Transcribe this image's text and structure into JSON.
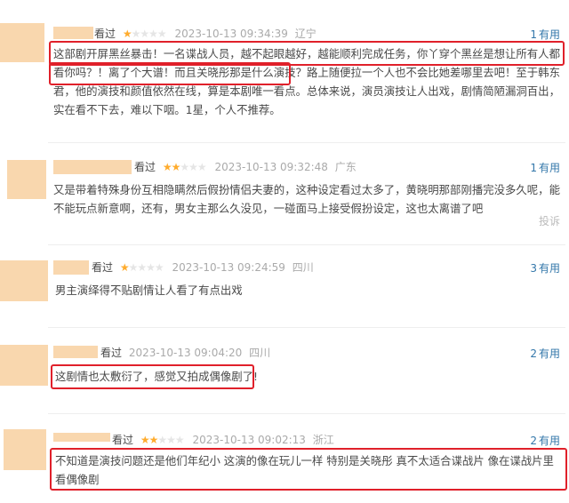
{
  "reviews": [
    {
      "watched": "看过",
      "stars": 1,
      "time": "2023-10-13 09:34:39",
      "location": "辽宁",
      "useful_count": "1",
      "useful_label": "有用",
      "content": "这部剧开屏黑丝暴击！一名谍战人员，越不起眼越好，越能顺利完成任务，你丫穿个黑丝是想让所有人都看你吗？！离了个大谱！而且关晓彤那是什么演技？路上随便拉一个人也不会比她差哪里去吧！至于韩东君，他的演技和颜值依然在线，算是本剧唯一看点。总体来说，演员演技让人出戏，剧情简陋漏洞百出，实在看不下去，难以下咽。1星，个人不推荐。"
    },
    {
      "watched": "看过",
      "stars": 2,
      "time": "2023-10-13 09:32:48",
      "location": "广东",
      "useful_count": "1",
      "useful_label": "有用",
      "content": "又是带着特殊身份互相隐瞒然后假扮情侣夫妻的，这种设定看过太多了，黄晓明那部刚播完没多久呢，能不能玩点新意啊，还有，男女主那么久没见，一碰面马上接受假扮设定，这也太离谱了吧",
      "report": "投诉"
    },
    {
      "watched": "看过",
      "stars": 1,
      "time": "2023-10-13 09:24:59",
      "location": "四川",
      "useful_count": "3",
      "useful_label": "有用",
      "content": "男主演绎得不贴剧情让人看了有点出戏"
    },
    {
      "watched": "看过",
      "stars": 0,
      "time": "2023-10-13 09:04:20",
      "location": "四川",
      "useful_count": "2",
      "useful_label": "有用",
      "content": "这剧情也太敷衍了，感觉又拍成偶像剧了!"
    },
    {
      "watched": "看过",
      "stars": 2,
      "time": "2023-10-13 09:02:13",
      "location": "浙江",
      "useful_count": "2",
      "useful_label": "有用",
      "content": "不知道是演技问题还是他们年纪小 这演的像在玩儿一样 特别是关晓彤 真不太适合谍战片 像在谍战片里看偶像剧"
    }
  ],
  "colors": {
    "avatar_placeholder": "#f9d7ae",
    "star_on": "#ffac2d",
    "star_off": "#e5e5e5",
    "highlight_box": "#e0202a",
    "useful_link": "#3377aa"
  }
}
